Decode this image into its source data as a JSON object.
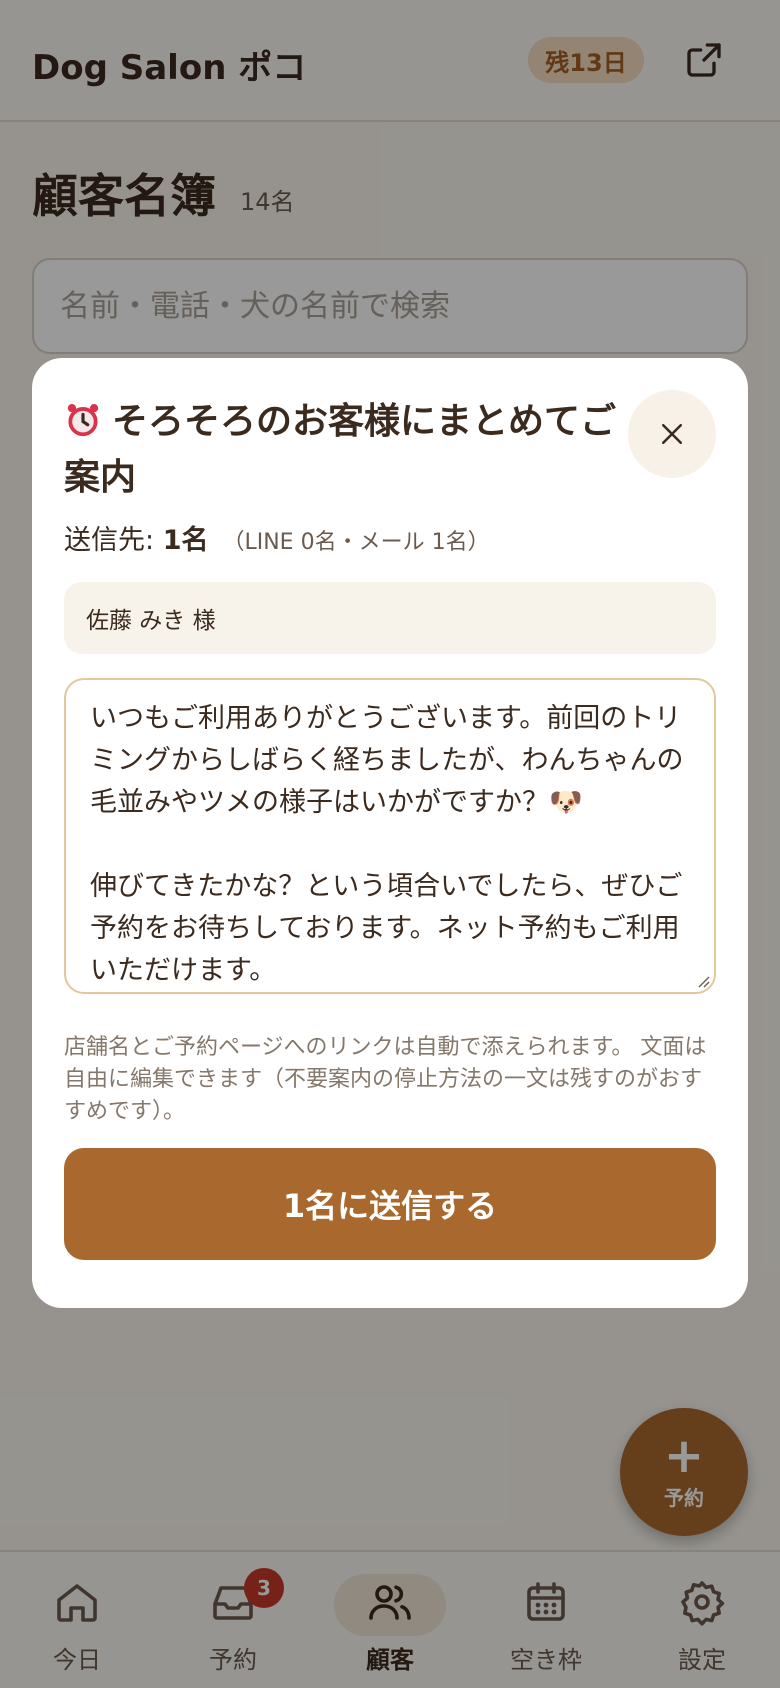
{
  "header": {
    "app_title": "Dog Salon ポコ",
    "trial_badge": "残13日",
    "external_icon": "external-link-icon"
  },
  "page": {
    "title": "顧客名簿",
    "count": "14名",
    "search_placeholder": "名前・電話・犬の名前で検索"
  },
  "modal": {
    "title": "そろそろのお客様にまとめてご案内",
    "title_icon": "alarm-clock-icon",
    "recipients_label": "送信先: ",
    "recipients_count": "1名",
    "recipients_breakdown": "（LINE 0名・メール 1名）",
    "recipient_chip": "佐藤 みき 様",
    "message": "いつもご利用ありがとうございます。前回のトリミングからしばらく経ちましたが、わんちゃんの毛並みやツメの様子はいかがですか？🐶\n\n伸びてきたかな？という頃合いでしたら、ぜひご予約をお待ちしております。ネット予約もご利用いただけます。",
    "note": "店舗名とご予約ページへのリンクは自動で添えられます。 文面は自由に編集できます（不要案内の停止方法の一文は残すのがおすすめです）。",
    "send_button": "1名に送信する"
  },
  "fab": {
    "label": "予約",
    "icon": "plus-icon"
  },
  "tabs": [
    {
      "label": "今日",
      "icon": "home-icon"
    },
    {
      "label": "予約",
      "icon": "inbox-icon",
      "badge": "3"
    },
    {
      "label": "顧客",
      "icon": "users-icon",
      "active": true
    },
    {
      "label": "空き枠",
      "icon": "calendar-icon"
    },
    {
      "label": "設定",
      "icon": "gear-icon"
    }
  ],
  "colors": {
    "accent": "#a8682e",
    "badge": "#c73a2a",
    "text": "#3b2a1e"
  }
}
